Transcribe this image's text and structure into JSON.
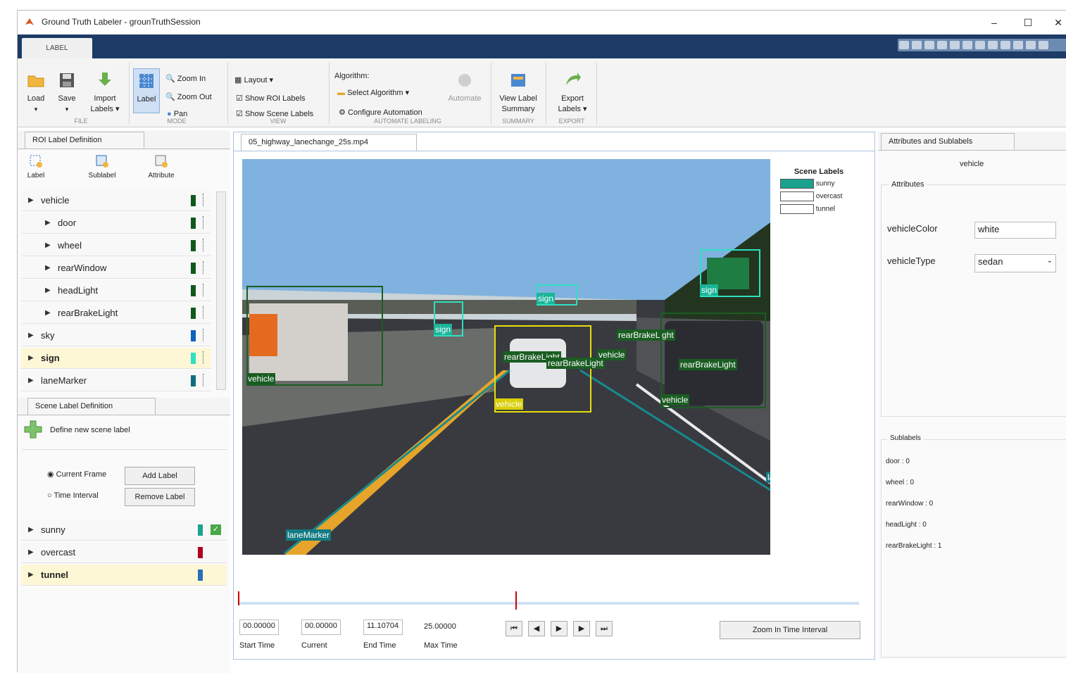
{
  "window": {
    "title": "Ground Truth Labeler - grounTruthSession",
    "minimize": "–",
    "maximize": "☐",
    "close": "✕"
  },
  "tabs": {
    "label": "LABEL"
  },
  "ribbon": {
    "load": "Load",
    "save": "Save",
    "import": "Import",
    "import2": "Labels ▾",
    "label": "Label",
    "zoom_in": "Zoom In",
    "zoom_out": "Zoom Out",
    "pan": "Pan",
    "layout": "Layout ▾",
    "show_roi": "Show ROI Labels",
    "show_scene": "Show Scene Labels",
    "algorithm": "Algorithm:",
    "select_algorithm": "Select Algorithm ▾",
    "configure": "Configure Automation",
    "automate": "Automate",
    "view_summary": "View Label",
    "view_summary2": "Summary",
    "export": "Export",
    "export2": "Labels ▾",
    "groups": {
      "file": "FILE",
      "mode": "MODE",
      "view": "VIEW",
      "automate": "AUTOMATE LABELING",
      "summary": "SUMMARY",
      "export": "EXPORT"
    }
  },
  "roi_panel": {
    "tab": "ROI Label Definition",
    "tools": [
      "Label",
      "Sublabel",
      "Attribute"
    ],
    "items": [
      {
        "label": "vehicle",
        "color": "#0f5a1a",
        "indent": 0
      },
      {
        "label": "door",
        "color": "#0f5a1a",
        "indent": 1
      },
      {
        "label": "wheel",
        "color": "#0f5a1a",
        "indent": 1
      },
      {
        "label": "rearWindow",
        "color": "#0f5a1a",
        "indent": 1
      },
      {
        "label": "headLight",
        "color": "#0f5a1a",
        "indent": 1
      },
      {
        "label": "rearBrakeLight",
        "color": "#0f5a1a",
        "indent": 1
      },
      {
        "label": "sky",
        "color": "#1060c0",
        "indent": 0
      },
      {
        "label": "sign",
        "color": "#2ee0c0",
        "indent": 0
      },
      {
        "label": "laneMarker",
        "color": "#0e6f7c",
        "indent": 0
      }
    ]
  },
  "scene_panel": {
    "tab": "Scene Label Definition",
    "define": "Define new scene label",
    "current_frame": "Current Frame",
    "time_interval": "Time Interval",
    "add": "Add Label",
    "remove": "Remove Label",
    "items": [
      {
        "label": "sunny",
        "color": "#1aa28e"
      },
      {
        "label": "overcast",
        "color": "#b00020"
      },
      {
        "label": "tunnel",
        "color": "#2a6fb7"
      }
    ]
  },
  "video": {
    "tab": "05_highway_lanechange_25s.mp4",
    "scene_legend": {
      "title": "Scene Labels",
      "items": [
        "sunny",
        "overcast",
        "tunnel"
      ]
    },
    "annotations": [
      "vehicle",
      "sign",
      "sign",
      "sign",
      "rearBrakeLight",
      "rearBrakeLight",
      "vehicle",
      "vehicle",
      "rearBrakeLight",
      "rearBrakeLight",
      "vehicle",
      "vehicle",
      "laneMarker",
      "laneMarker"
    ]
  },
  "timeline": {
    "start": "00.00000",
    "current": "00.00000",
    "end": "11.10704",
    "max": "25.00000",
    "start_label": "Start Time",
    "current_label": "Current",
    "end_label": "End Time",
    "max_label": "Max Time",
    "zoom": "Zoom In Time Interval"
  },
  "attr_panel": {
    "tab": "Attributes and Sublabels",
    "selected": "vehicle",
    "attributes_title": "Attributes",
    "color_label": "vehicleColor",
    "color_value": "white",
    "type_label": "vehicleType",
    "type_value": "sedan",
    "sublabels_title": "Sublabels",
    "sublabels": [
      "door : 0",
      "wheel : 0",
      "rearWindow : 0",
      "headLight : 0",
      "rearBrakeLight : 1"
    ]
  }
}
